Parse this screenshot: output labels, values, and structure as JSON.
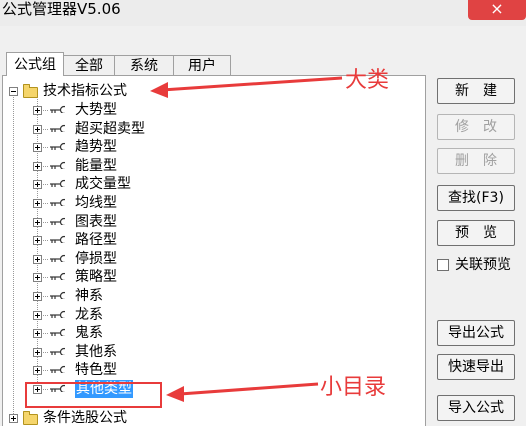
{
  "window": {
    "title": "公式管理器V5.06",
    "close_label": "×"
  },
  "tabs": [
    {
      "label": "公式组",
      "active": true
    },
    {
      "label": "全部",
      "active": false
    },
    {
      "label": "系统",
      "active": false
    },
    {
      "label": "用户",
      "active": false
    }
  ],
  "tree": {
    "root": "技术指标公式",
    "children": [
      "大势型",
      "超买超卖型",
      "趋势型",
      "能量型",
      "成交量型",
      "均线型",
      "图表型",
      "路径型",
      "停损型",
      "策略型",
      "神系",
      "龙系",
      "鬼系",
      "其他系",
      "特色型",
      "其他类型"
    ],
    "selected": "其他类型",
    "next_root": "条件选股公式"
  },
  "buttons": {
    "new": "新　建",
    "modify": "修　改",
    "delete": "删　除",
    "find": "查找(F3)",
    "preview": "预　览",
    "export": "导出公式",
    "quick_export": "快速导出",
    "import": "导入公式"
  },
  "linked_preview": {
    "label": "关联预览",
    "checked": false
  },
  "annotations": {
    "category": "大类",
    "subcategory": "小目录",
    "color": "#e83b3b"
  }
}
